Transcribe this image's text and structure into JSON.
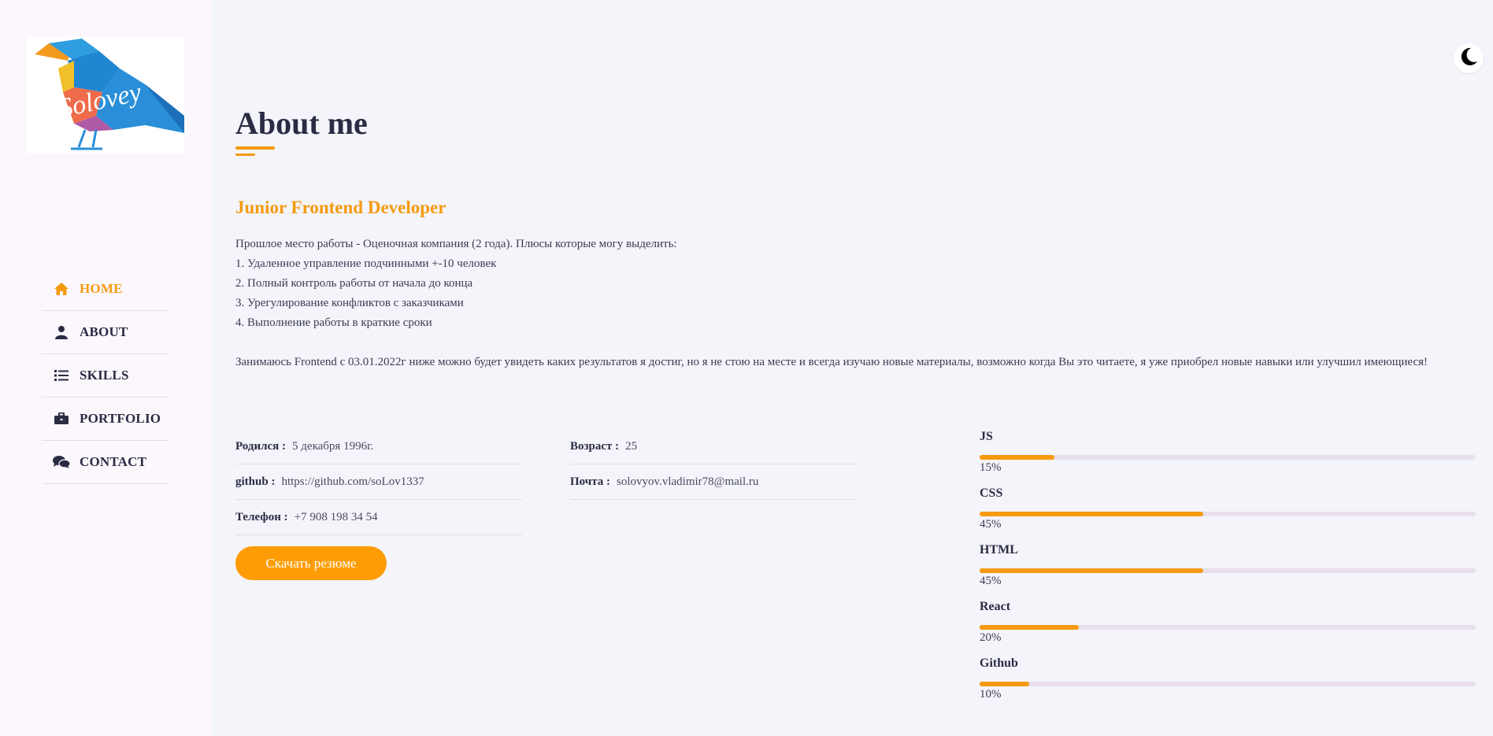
{
  "logo": {
    "text": "Solovey"
  },
  "nav": {
    "items": [
      {
        "label": "HOME",
        "icon": "home-icon",
        "active": true
      },
      {
        "label": "ABOUT",
        "icon": "user-icon",
        "active": false
      },
      {
        "label": "SKILLS",
        "icon": "list-icon",
        "active": false
      },
      {
        "label": "PORTFOLIO",
        "icon": "briefcase-icon",
        "active": false
      },
      {
        "label": "CONTACT",
        "icon": "comments-icon",
        "active": false
      }
    ]
  },
  "theme_toggle": {
    "icon": "moon-icon"
  },
  "about": {
    "title": "About me",
    "role": "Junior Frontend Developer",
    "lines": [
      "Прошлое место работы - Оценочная компания (2 года). Плюсы которые могу выделить:",
      "1. Удаленное управление подчинными +-10 человек",
      "2. Полный контроль работы от начала до конца",
      "3. Урегулирование конфликтов с заказчиками",
      "4. Выполнение работы в краткие сроки"
    ],
    "paragraph": "Занимаюсь Frontend с 03.01.2022г ниже можно будет увидеть каких результатов я достиг, но я не стою на месте и всегда изучаю новые материалы, возможно когда Вы это читаете, я уже приобрел новые навыки или улучшил имеющиеся!"
  },
  "info": {
    "left": [
      {
        "key": "Родился :",
        "value": "5 декабря 1996г."
      },
      {
        "key": "github :",
        "value": "https://github.com/soLov1337"
      },
      {
        "key": "Телефон :",
        "value": "+7 908 198 34 54"
      }
    ],
    "right": [
      {
        "key": "Возраст :",
        "value": "25"
      },
      {
        "key": "Почта :",
        "value": "solovyov.vladimir78@mail.ru"
      }
    ]
  },
  "cv_button": {
    "label": "Скачать резюме"
  },
  "skills": [
    {
      "name": "JS",
      "percent": 15,
      "label": "15%"
    },
    {
      "name": "CSS",
      "percent": 45,
      "label": "45%"
    },
    {
      "name": "HTML",
      "percent": 45,
      "label": "45%"
    },
    {
      "name": "React",
      "percent": 20,
      "label": "20%"
    },
    {
      "name": "Github",
      "percent": 10,
      "label": "10%"
    }
  ],
  "colors": {
    "accent": "#f59a0f",
    "button": "#fd9c05",
    "text": "#2b2b44",
    "sidebar_bg": "#fbf7fc",
    "main_bg": "#f4f4fb"
  }
}
